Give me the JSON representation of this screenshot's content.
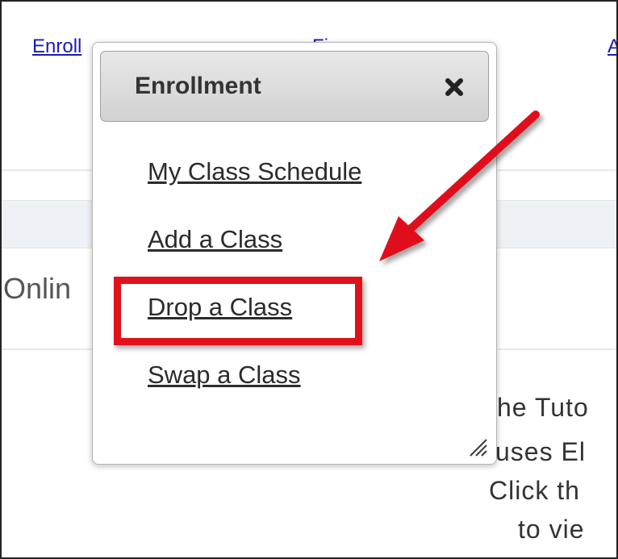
{
  "background": {
    "nav_links": [
      "Enroll",
      "Finances",
      "A"
    ],
    "heading_fragment": "Onlin",
    "text_lines": [
      "he Tuto",
      "uses El",
      "Click th",
      "to vie"
    ]
  },
  "popup": {
    "title": "Enrollment",
    "items": [
      {
        "label": "My Class Schedule"
      },
      {
        "label": "Add a Class"
      },
      {
        "label": "Drop a Class"
      },
      {
        "label": "Swap a Class"
      }
    ]
  },
  "icons": {
    "close": "close-icon",
    "resize": "resize-handle-icon",
    "arrow": "arrow-annotation"
  },
  "colors": {
    "annotation": "#e0111a",
    "link": "#1b1bb0"
  }
}
